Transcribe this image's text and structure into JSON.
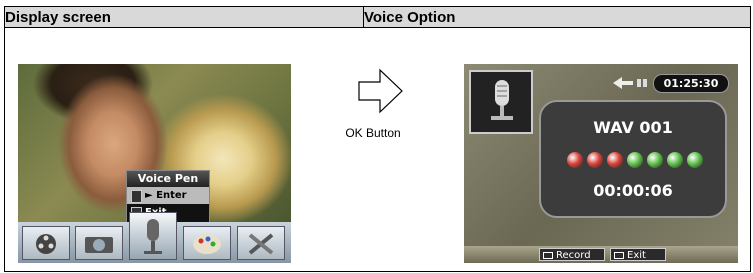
{
  "header": {
    "left": "Display screen",
    "right": "Voice Option"
  },
  "popup": {
    "title": "Voice Pen",
    "items": [
      "► Enter",
      "Exit"
    ]
  },
  "ok_label": "OK Button",
  "recorder": {
    "timer": "01:25:30",
    "file": "WAV 001",
    "elapsed": "00:00:06",
    "record_label": "Record",
    "exit_label": "Exit",
    "dots": [
      "red",
      "red",
      "red",
      "green",
      "green",
      "green",
      "green"
    ],
    "dot_colors": {
      "red": "#d8423a",
      "green": "#5fbf4a"
    }
  },
  "mode_icons": [
    "film-reel-icon",
    "camera-icon",
    "microphone-icon",
    "palette-icon",
    "tools-icon"
  ]
}
